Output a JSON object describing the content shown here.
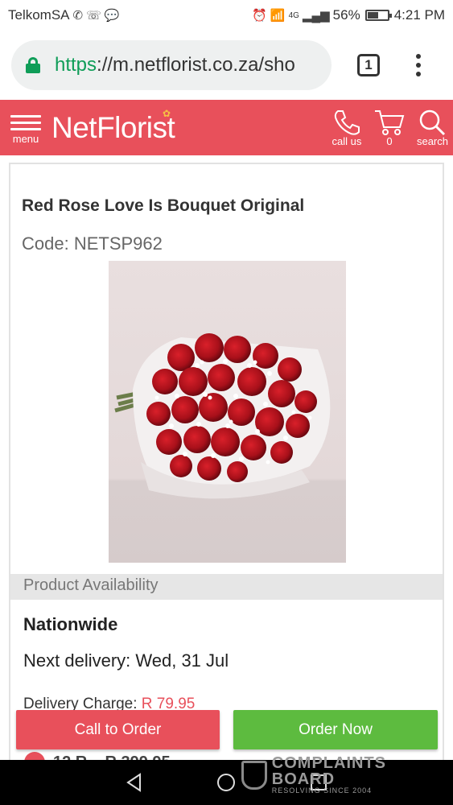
{
  "status_bar": {
    "carrier": "TelkomSA",
    "network": "4G",
    "battery": "56%",
    "battery_level": 0.56,
    "time": "4:21 PM"
  },
  "browser": {
    "url_scheme": "https",
    "url_rest": "://m.netflorist.co.za/sho",
    "tab_count": "1"
  },
  "header": {
    "menu_label": "menu",
    "logo": "NetFlorist",
    "call_label": "call us",
    "cart_count": "0",
    "search_label": "search",
    "brand_color": "#e8505b"
  },
  "product": {
    "title": "Red Rose Love Is Bouquet Original",
    "code": "Code: NETSP962",
    "availability_heading": "Product Availability",
    "availability": "Nationwide",
    "next_delivery": "Next delivery: Wed, 31 Jul",
    "delivery_charge_label": "Delivery Charge: ",
    "delivery_charge_value": "R 79.95"
  },
  "buttons": {
    "call_to_order": "Call to Order",
    "order_now": "Order Now"
  },
  "peek_row": {
    "text": "12 R...        R 399.95"
  },
  "watermark": {
    "name": "COMPLAINTS BOARD",
    "tagline": "RESOLVING SINCE 2004"
  }
}
